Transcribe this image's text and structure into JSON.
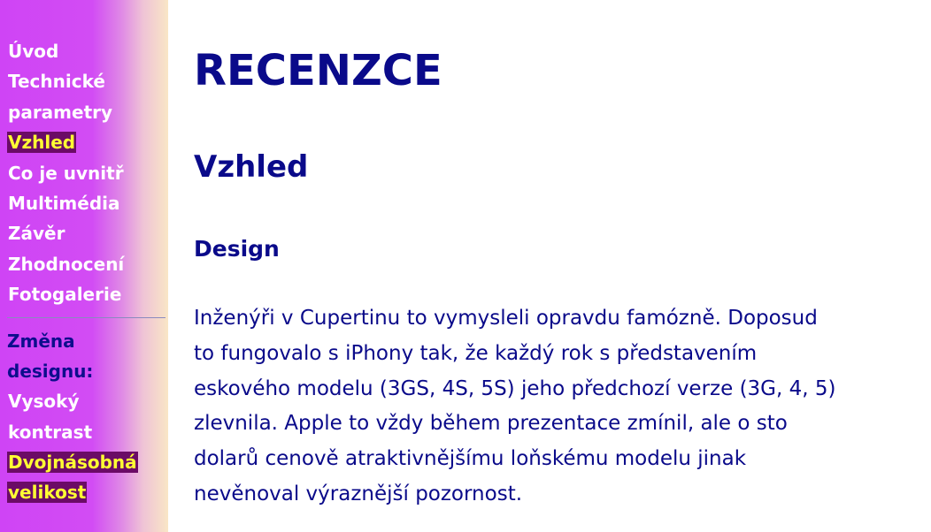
{
  "sidebar": {
    "nav_items": [
      {
        "label": "Úvod"
      },
      {
        "label": "Technické"
      },
      {
        "label": "parametry"
      },
      {
        "label": "Vzhled"
      },
      {
        "label": "Co je uvnitř"
      },
      {
        "label": "Multimédia"
      },
      {
        "label": "Závěr"
      },
      {
        "label": "Zhodnocení"
      },
      {
        "label": "Fotogalerie"
      }
    ],
    "active_nav": "Vzhled",
    "design_label_1": "Změna",
    "design_label_2": "designu:",
    "design_items": [
      {
        "label": "Vysoký"
      },
      {
        "label": "kontrast"
      },
      {
        "label": "Dvojnásobná"
      },
      {
        "label": "velikost"
      }
    ]
  },
  "main": {
    "title": "RECENZCE",
    "section_title": "Vzhled",
    "subsection_title": "Design",
    "paragraph_lines": [
      "Inženýři v Cupertinu to vymysleli opravdu famózně. Doposud",
      "to fungovalo s iPhony tak, že každý rok s představením",
      "eskového modelu (3GS, 4S, 5S) jeho předchozí verze (3G, 4, 5)",
      "zlevnila. Apple to vždy během prezentace zmínil, ale o sto",
      "dolarů cenově atraktivnějšímu loňskému modelu jinak",
      "nevěnoval výraznější pozornost."
    ]
  },
  "colors": {
    "text": "#0a0a8a",
    "highlight_bg": "#6b0b66",
    "highlight_text": "#ffff33",
    "sidebar_purple": "#cf44f5"
  }
}
